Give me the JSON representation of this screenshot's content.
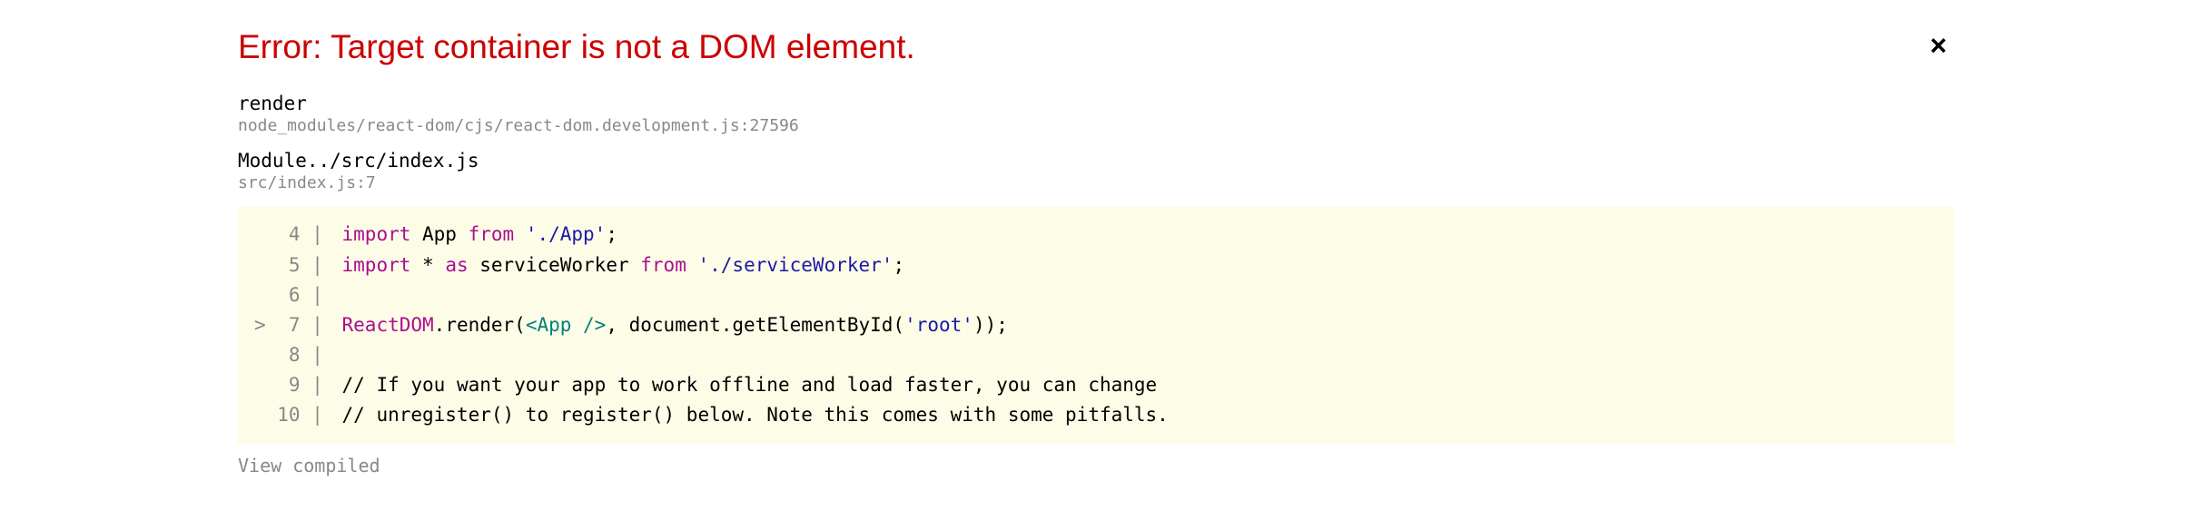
{
  "header": {
    "title": "Error: Target container is not a DOM element.",
    "close_label": "×"
  },
  "frames": [
    {
      "function": "render",
      "location": "node_modules/react-dom/cjs/react-dom.development.js:27596"
    },
    {
      "function": "Module../src/index.js",
      "location": "src/index.js:7"
    }
  ],
  "code": {
    "lines": [
      {
        "gutter": "   4 | ",
        "tokens": [
          {
            "t": "import",
            "c": "tok-keyword"
          },
          {
            "t": " App ",
            "c": ""
          },
          {
            "t": "from",
            "c": "tok-keyword"
          },
          {
            "t": " ",
            "c": ""
          },
          {
            "t": "'./App'",
            "c": "tok-string"
          },
          {
            "t": ";",
            "c": ""
          }
        ]
      },
      {
        "gutter": "   5 | ",
        "tokens": [
          {
            "t": "import",
            "c": "tok-keyword"
          },
          {
            "t": " * ",
            "c": ""
          },
          {
            "t": "as",
            "c": "tok-keyword"
          },
          {
            "t": " serviceWorker ",
            "c": ""
          },
          {
            "t": "from",
            "c": "tok-keyword"
          },
          {
            "t": " ",
            "c": ""
          },
          {
            "t": "'./serviceWorker'",
            "c": "tok-string"
          },
          {
            "t": ";",
            "c": ""
          }
        ]
      },
      {
        "gutter": "   6 | ",
        "tokens": []
      },
      {
        "gutter": ">  7 | ",
        "tokens": [
          {
            "t": "ReactDOM",
            "c": "tok-keyword"
          },
          {
            "t": ".render(",
            "c": ""
          },
          {
            "t": "<App />",
            "c": "tok-tag"
          },
          {
            "t": ", document.getElementById(",
            "c": ""
          },
          {
            "t": "'root'",
            "c": "tok-string"
          },
          {
            "t": "));",
            "c": ""
          }
        ]
      },
      {
        "gutter": "   8 | ",
        "tokens": []
      },
      {
        "gutter": "   9 | ",
        "tokens": [
          {
            "t": "// If you want your app to work offline and load faster, you can change",
            "c": ""
          }
        ]
      },
      {
        "gutter": "  10 | ",
        "tokens": [
          {
            "t": "// unregister() to register() below. Note this comes with some pitfalls.",
            "c": ""
          }
        ]
      }
    ]
  },
  "footer": {
    "view_compiled_label": "View compiled"
  }
}
